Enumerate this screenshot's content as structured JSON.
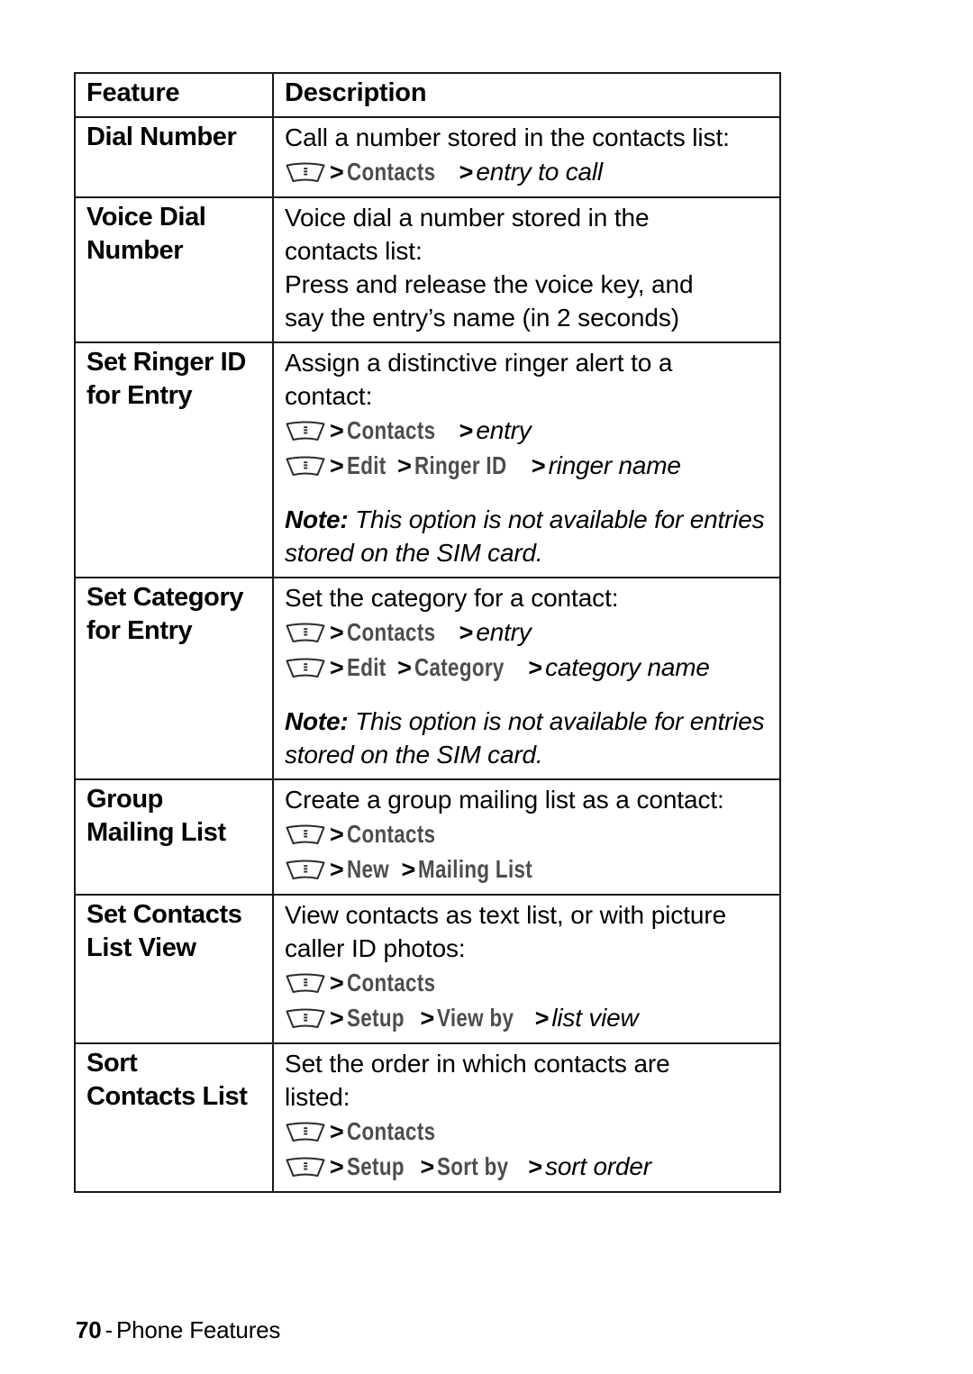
{
  "page": {
    "footer_page_number": "70",
    "footer_separator": "-",
    "footer_section": "Phone Features"
  },
  "icons": {
    "menu_key": "menu-key-icon"
  },
  "colors": {
    "menu_name": "#4d4d4d",
    "border": "#1a1a1a",
    "text": "#000000",
    "background": "#ffffff"
  },
  "table": {
    "headers": {
      "feature": "Feature",
      "description": "Description"
    },
    "rows": [
      {
        "feature_lines": [
          "Dial Number"
        ],
        "desc_lines": [
          "Call a number stored in the contacts list:"
        ],
        "paths": [
          {
            "menu": [
              "Contacts"
            ],
            "var": "entry to call"
          }
        ],
        "note": null
      },
      {
        "feature_lines": [
          "Voice Dial",
          "Number"
        ],
        "desc_lines": [
          "Voice dial a number stored in the",
          "contacts list:",
          "Press and release the voice key, and",
          "say the entry’s name (in 2 seconds)"
        ],
        "paths": [],
        "note": null
      },
      {
        "feature_lines": [
          "Set Ringer ID",
          "for Entry"
        ],
        "desc_lines": [
          "Assign a distinctive ringer alert to a",
          "contact:"
        ],
        "paths": [
          {
            "menu": [
              "Contacts"
            ],
            "var": "entry"
          },
          {
            "menu": [
              "Edit",
              "Ringer ID"
            ],
            "var": "ringer name"
          }
        ],
        "note": {
          "label": "Note:",
          "text": " This option is not available for entries stored on the SIM card."
        }
      },
      {
        "feature_lines": [
          "Set Category",
          "for Entry"
        ],
        "desc_lines": [
          "Set the category for a contact:"
        ],
        "paths": [
          {
            "menu": [
              "Contacts"
            ],
            "var": "entry"
          },
          {
            "menu": [
              "Edit",
              "Category"
            ],
            "var": "category name"
          }
        ],
        "note": {
          "label": "Note:",
          "text": " This option is not available for entries stored on the SIM card."
        }
      },
      {
        "feature_lines": [
          "Group",
          "Mailing List"
        ],
        "desc_lines": [
          "Create a group mailing list as a contact:"
        ],
        "paths": [
          {
            "menu": [
              "Contacts"
            ],
            "var": null
          },
          {
            "menu": [
              "New",
              "Mailing List"
            ],
            "var": null
          }
        ],
        "note": null
      },
      {
        "feature_lines": [
          "Set Contacts",
          "List View"
        ],
        "desc_lines": [
          "View contacts as text list, or with picture",
          "caller ID photos:"
        ],
        "paths": [
          {
            "menu": [
              "Contacts"
            ],
            "var": null
          },
          {
            "menu": [
              "Setup",
              "View by"
            ],
            "var": "list view"
          }
        ],
        "note": null
      },
      {
        "feature_lines": [
          "Sort",
          "Contacts List"
        ],
        "desc_lines": [
          "Set the order in which contacts are",
          "listed:"
        ],
        "paths": [
          {
            "menu": [
              "Contacts"
            ],
            "var": null
          },
          {
            "menu": [
              "Setup",
              "Sort by"
            ],
            "var": "sort order"
          }
        ],
        "note": null
      }
    ]
  }
}
